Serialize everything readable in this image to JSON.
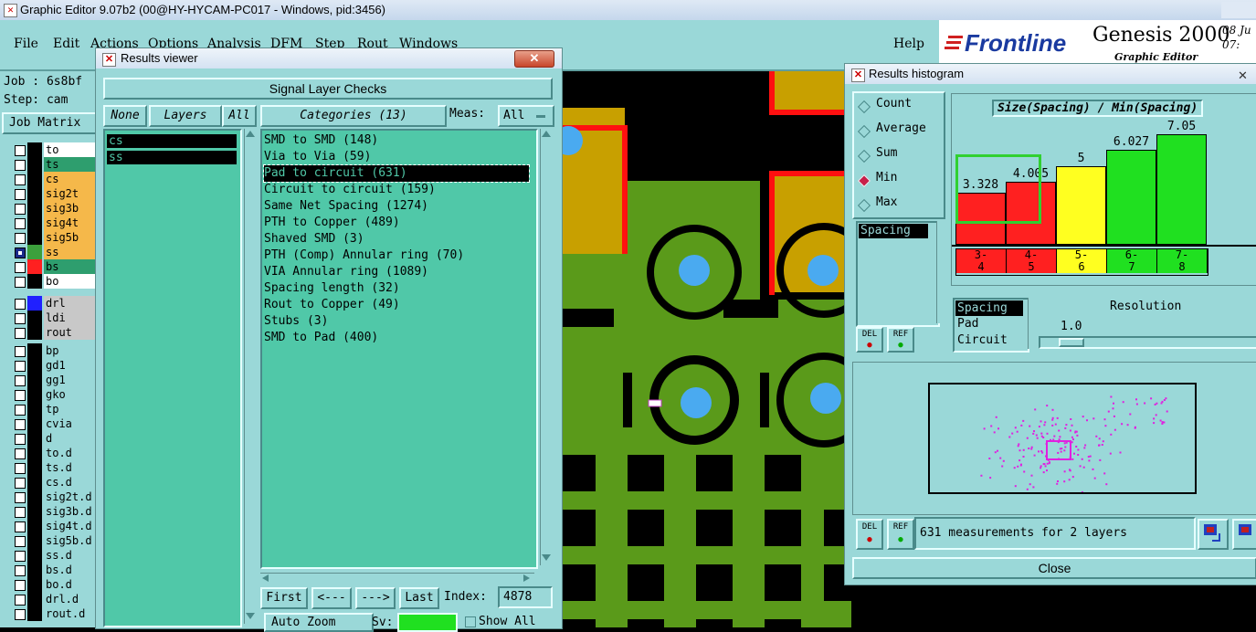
{
  "app": {
    "title": "Graphic Editor 9.07b2 (00@HY-HYCAM-PC017 - Windows, pid:3456)",
    "menus": [
      "File",
      "Edit",
      "Actions",
      "Options",
      "Analysis",
      "DFM",
      "Step",
      "Rout",
      "Windows"
    ],
    "help": "Help",
    "brand": "Frontline",
    "product": "Genesis 2000",
    "subtitle": "Graphic Editor",
    "date_fragment": "08 Ju",
    "time_fragment": "07:"
  },
  "job": {
    "job_label": "Job : 6s8bf",
    "step_label": "Step: cam",
    "matrix_button": "Job Matrix"
  },
  "layers": [
    {
      "name": "to",
      "color": "#ffffff",
      "swatch": "#000000",
      "sel": false
    },
    {
      "name": "ts",
      "color": "#2e9e6e",
      "swatch": "#000000",
      "sel": false
    },
    {
      "name": "cs",
      "color": "#f5b84a",
      "swatch": "#000000",
      "sel": false
    },
    {
      "name": "sig2t",
      "color": "#f5b84a",
      "swatch": "#000000",
      "sel": false
    },
    {
      "name": "sig3b",
      "color": "#f5b84a",
      "swatch": "#000000",
      "sel": false
    },
    {
      "name": "sig4t",
      "color": "#f5b84a",
      "swatch": "#000000",
      "sel": false
    },
    {
      "name": "sig5b",
      "color": "#f5b84a",
      "swatch": "#000000",
      "sel": false
    },
    {
      "name": "ss",
      "color": "#f5b84a",
      "swatch": "#3ca03c",
      "sel": true
    },
    {
      "name": "bs",
      "color": "#2e9e6e",
      "swatch": "#ff2020",
      "sel": false
    },
    {
      "name": "bo",
      "color": "#ffffff",
      "swatch": "#000000",
      "sel": false
    }
  ],
  "layers2": [
    {
      "name": "drl",
      "color": "#c8c8c8",
      "swatch": "#2020ff"
    },
    {
      "name": "ldi",
      "color": "#c8c8c8",
      "swatch": "#000000"
    },
    {
      "name": "rout",
      "color": "#c8c8c8",
      "swatch": "#000000"
    }
  ],
  "layers3": [
    "bp",
    "gd1",
    "gg1",
    "gko",
    "tp",
    "cvia",
    "d",
    "to.d",
    "ts.d",
    "cs.d",
    "sig2t.d",
    "sig3b.d",
    "sig4t.d",
    "sig5b.d",
    "ss.d",
    "bs.d",
    "bo.d",
    "drl.d",
    "rout.d"
  ],
  "results_viewer": {
    "title": "Results viewer",
    "header": "Signal Layer Checks",
    "none_btn": "None",
    "layers_btn": "Layers",
    "all_btn": "All",
    "categories_btn": "Categories (13)",
    "meas_label": "Meas:",
    "meas_value": "All",
    "selected_layers": [
      "cs",
      "ss"
    ],
    "categories": [
      "SMD to SMD (148)",
      "Via to Via (59)",
      "Pad to circuit (631)",
      "Circuit to circuit (159)",
      "Same Net Spacing (1274)",
      "PTH to Copper (489)",
      "Shaved SMD (3)",
      "PTH (Comp) Annular ring (70)",
      "VIA Annular ring (1089)",
      "Spacing length (32)",
      "Rout to Copper (49)",
      "Stubs (3)",
      "SMD to Pad (400)"
    ],
    "selected_category_index": 2,
    "first_btn": "First",
    "prev_btn": "<---",
    "next_btn": "--->",
    "last_btn": "Last",
    "index_label": "Index:",
    "index_value": "4878",
    "auto_zoom": "Auto Zoom",
    "sv_label": "Sv:",
    "show_all": "Show All"
  },
  "histogram": {
    "title": "Results histogram",
    "modes": [
      "Count",
      "Average",
      "Sum",
      "Min",
      "Max"
    ],
    "selected_mode": "Min",
    "measure_label": "Spacing",
    "chart_title": "Size(Spacing) / Min(Spacing)",
    "bars": [
      {
        "range": "3-\n4",
        "value": "3.328",
        "color": "#ff2020"
      },
      {
        "range": "4-\n5",
        "value": "4.005",
        "color": "#ff2020"
      },
      {
        "range": "5-\n6",
        "value": "5",
        "color": "#ffff20"
      },
      {
        "range": "6-\n7",
        "value": "6.027",
        "color": "#20e020"
      },
      {
        "range": "7-\n8",
        "value": "7.05",
        "color": "#20e020"
      }
    ],
    "fields": [
      "Spacing",
      "Pad",
      "Circuit"
    ],
    "resolution_label": "Resolution",
    "resolution_value": "1.0",
    "del_btn": "DEL",
    "ref_btn": "REF",
    "status": "631 measurements for 2 layers",
    "close_btn": "Close"
  },
  "colors": {
    "panel": "#9ad8d8",
    "list": "#50c8a8",
    "pcb_green": "#5a9a1a",
    "pad_blue": "#4aaaf0"
  }
}
